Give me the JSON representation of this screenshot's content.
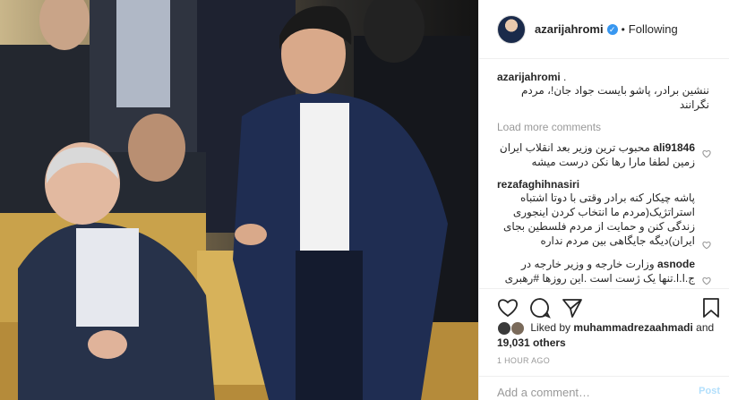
{
  "header": {
    "username": "azarijahromi",
    "separator": "•",
    "follow_label": "Following"
  },
  "caption": {
    "username": "azarijahromi",
    "username_suffix": ".",
    "text": "ننشین برادر، پاشو بایست جواد جان!، مردم نگرانند"
  },
  "load_more": "Load more comments",
  "comments": [
    {
      "username": "ali91846",
      "text": "محبوب ترین وزیر بعد انقلاب ایران زمین لطفا مارا رها نکن درست میشه"
    },
    {
      "username": "rezafaghihnasiri",
      "text": "پاشه چیکار کنه برادر وقتی با دوتا اشتباه استراتژیک(مردم ما انتخاب کردن اینجوری زندگی کنن و حمایت از مردم فلسطین بجای ایران)دیگه جایگاهی بین مردم نداره"
    },
    {
      "username": "asnode",
      "text": "وزارت خارجه و وزیر خارجه در ج.ا.ا.تنها یک ژست است .این روزها #رهبری دارند دیپلماسی کشور را تعیین..."
    }
  ],
  "likes": {
    "prefix": "Liked by",
    "user": "muhammadrezaahmadi",
    "and": "and",
    "count": "19,031 others"
  },
  "timestamp": "1 HOUR AGO",
  "add_comment": {
    "placeholder": "Add a comment…",
    "post_label": "Post"
  },
  "icons": {
    "like": "heart-icon",
    "comment": "comment-icon",
    "share": "share-icon",
    "save": "bookmark-icon",
    "verified": "verified-badge-icon"
  },
  "colors": {
    "accent": "#3897f0",
    "text": "#262626",
    "muted": "#999999",
    "border": "#efefef"
  }
}
